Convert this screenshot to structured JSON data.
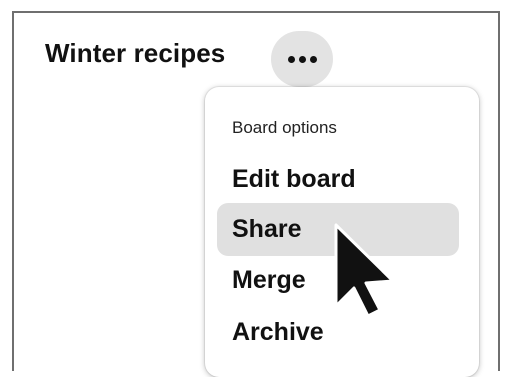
{
  "board": {
    "title": "Winter recipes",
    "more_icon": "ellipsis-icon"
  },
  "menu": {
    "header": "Board options",
    "items": [
      {
        "label": "Edit board"
      },
      {
        "label": "Share",
        "highlighted": true
      },
      {
        "label": "Merge"
      },
      {
        "label": "Archive"
      }
    ]
  },
  "colors": {
    "highlight": "#e0e0e0",
    "button_bg": "#e3e3e3",
    "text": "#111111"
  },
  "pointer": {
    "icon": "mouse-pointer-icon",
    "hover_item": "Share"
  }
}
